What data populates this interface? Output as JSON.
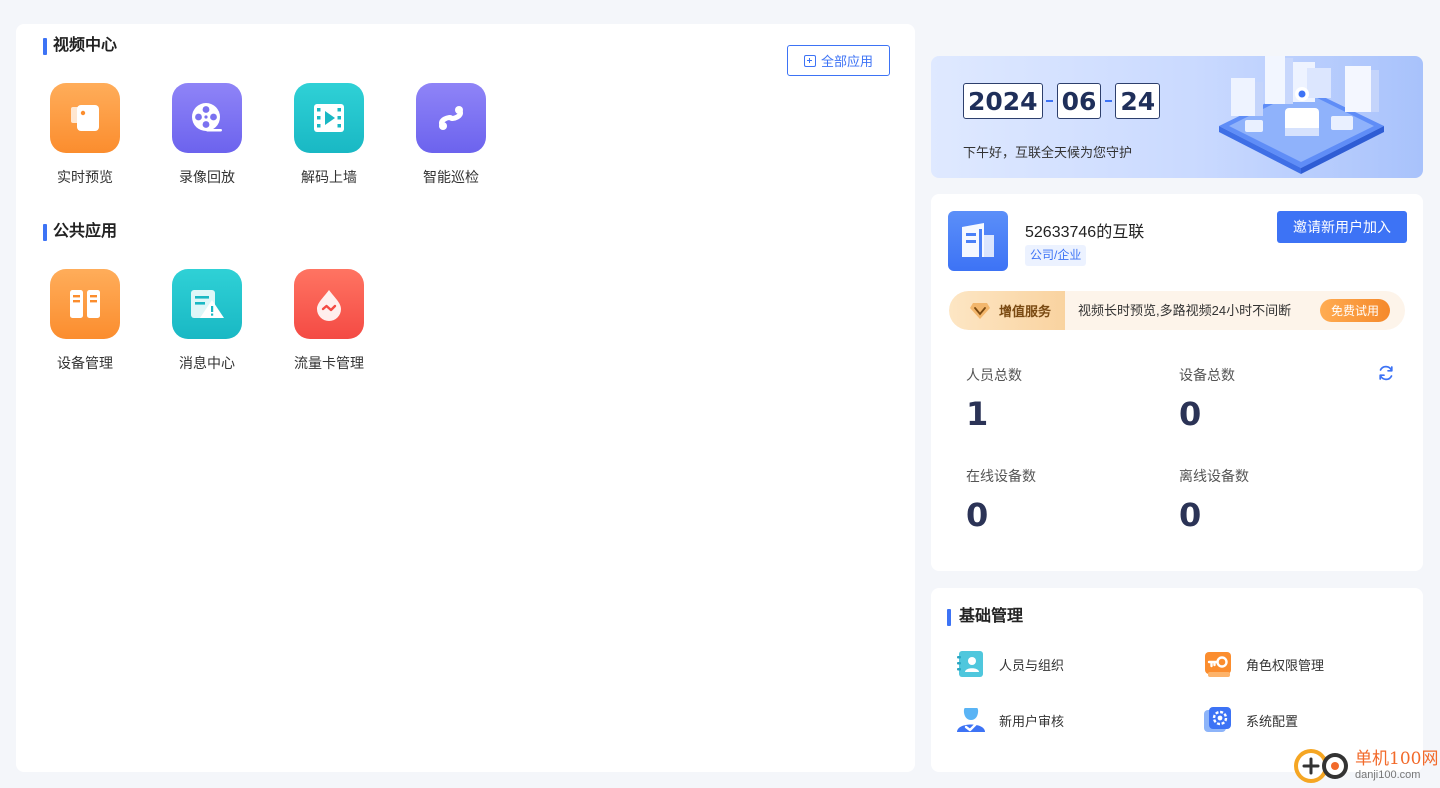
{
  "video_center": {
    "title": "视频中心",
    "all_apps_label": "全部应用",
    "apps": [
      {
        "label": "实时预览",
        "icon": "camera-icon",
        "color": "#fb8d2e"
      },
      {
        "label": "录像回放",
        "icon": "film-reel-icon",
        "color": "#6c63ee"
      },
      {
        "label": "解码上墙",
        "icon": "video-wall-icon",
        "color": "#19b8c4"
      },
      {
        "label": "智能巡检",
        "icon": "patrol-route-icon",
        "color": "#6c63ee"
      }
    ]
  },
  "public_apps": {
    "title": "公共应用",
    "apps": [
      {
        "label": "设备管理",
        "icon": "device-cabinet-icon",
        "color": "#fb8d2e"
      },
      {
        "label": "消息中心",
        "icon": "message-alert-icon",
        "color": "#19b8c4"
      },
      {
        "label": "流量卡管理",
        "icon": "data-drop-icon",
        "color": "#f44a44"
      }
    ]
  },
  "date_banner": {
    "year": "2024",
    "month": "06",
    "day": "24",
    "greeting": "下午好，互联全天候为您守护"
  },
  "organization": {
    "name": "52633746的互联",
    "tag": "公司/企业",
    "invite_label": "邀请新用户加入",
    "vip": {
      "label": "增值服务",
      "description": "视频长时预览,多路视频24小时不间断",
      "trial_label": "免费试用"
    },
    "stats": [
      {
        "label": "人员总数",
        "value": "1"
      },
      {
        "label": "设备总数",
        "value": "0"
      },
      {
        "label": "在线设备数",
        "value": "0"
      },
      {
        "label": "离线设备数",
        "value": "0"
      }
    ]
  },
  "basic_management": {
    "title": "基础管理",
    "items": [
      {
        "label": "人员与组织",
        "icon": "contacts-book-icon"
      },
      {
        "label": "角色权限管理",
        "icon": "key-icon"
      },
      {
        "label": "新用户审核",
        "icon": "user-check-icon"
      },
      {
        "label": "系统配置",
        "icon": "settings-gear-icon"
      }
    ]
  },
  "watermark": {
    "name_cn": "单机100网",
    "name_en": "danji100.com"
  },
  "colors": {
    "accent": "#3d73f5",
    "background": "#f4f6fa",
    "stat_value": "#2b3356"
  }
}
